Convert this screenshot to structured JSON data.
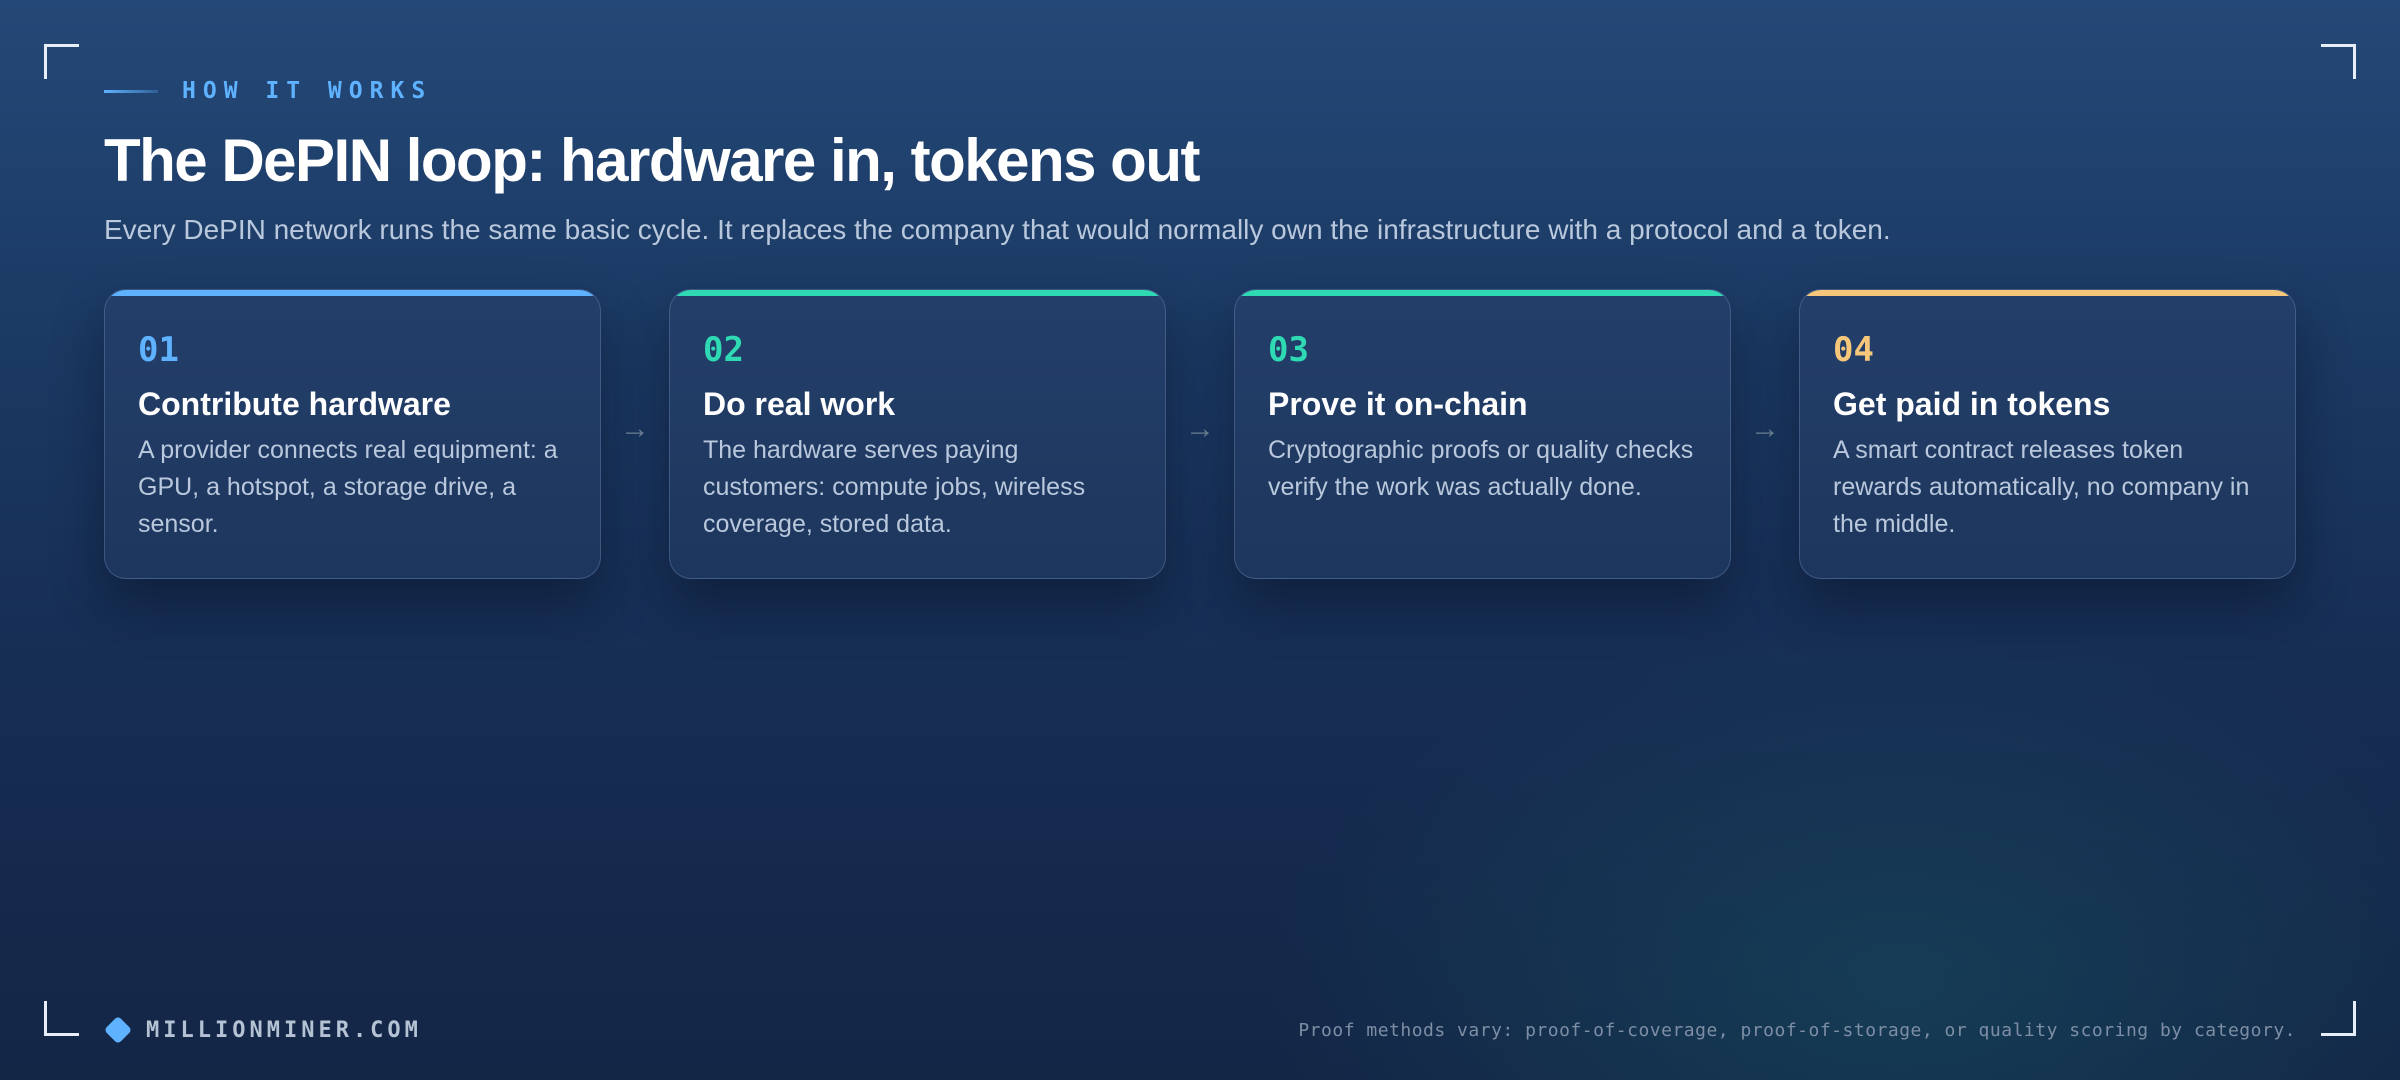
{
  "header": {
    "eyebrow": "HOW IT WORKS",
    "title": "The DePIN loop: hardware in, tokens out",
    "subtitle": "Every DePIN network runs the same basic cycle. It replaces the company that would normally own the infrastructure with a protocol and a token."
  },
  "steps": [
    {
      "number": "01",
      "title": "Contribute hardware",
      "description": "A provider connects real equipment: a GPU, a hotspot, a storage drive, a sensor.",
      "accent": "#5fb2ff"
    },
    {
      "number": "02",
      "title": "Do real work",
      "description": "The hardware serves paying customers: compute jobs, wireless coverage, stored data.",
      "accent": "#2fd9b4"
    },
    {
      "number": "03",
      "title": "Prove it on-chain",
      "description": "Cryptographic proofs or quality checks verify the work was actually done.",
      "accent": "#2fd9b4"
    },
    {
      "number": "04",
      "title": "Get paid in tokens",
      "description": "A smart contract releases token rewards automatically, no company in the middle.",
      "accent": "#f6c77a"
    }
  ],
  "arrow_glyph": "→",
  "footer": {
    "brand": "MILLIONMINER.COM",
    "note": "Proof methods vary: proof-of-coverage, proof-of-storage, or quality scoring by category."
  },
  "colors": {
    "brand_accent": "#5fb2ff",
    "teal_accent": "#2fd9b4",
    "gold_accent": "#f6c77a"
  }
}
